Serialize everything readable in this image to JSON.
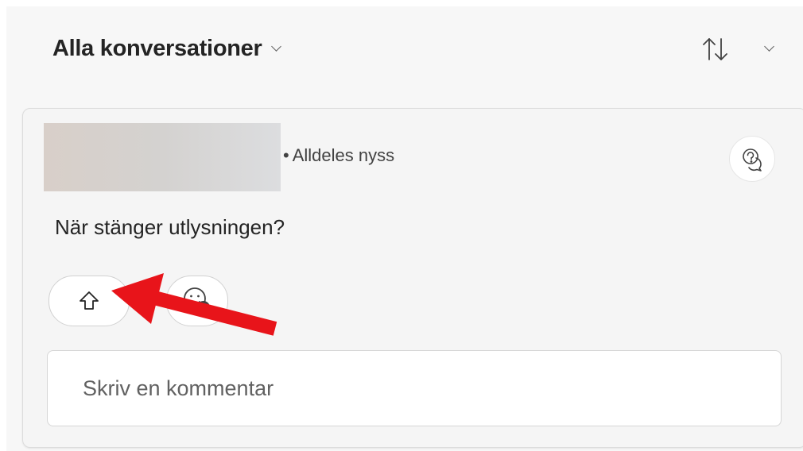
{
  "header": {
    "filter_label": "Alla konversationer",
    "filter_icon": "chevron-down-icon",
    "sort_icon": "sort-up-down-icon",
    "sort_menu_icon": "chevron-down-icon"
  },
  "post": {
    "meta_separator": "•",
    "timestamp": "Alldeles nyss",
    "question": "När stänger utlysningen?",
    "help_icon": "question-chat-icon",
    "upvote_icon": "arrow-up-icon",
    "react_icon": "emoji-add-icon"
  },
  "comment": {
    "placeholder": "Skriv en kommentar",
    "value": ""
  },
  "annotation": {
    "arrow_color": "#e8141a",
    "arrow_target": "upvote-button"
  },
  "colors": {
    "text_primary": "#242424",
    "text_secondary": "#424242",
    "background": "#f7f7f7",
    "card": "#f5f5f5"
  }
}
